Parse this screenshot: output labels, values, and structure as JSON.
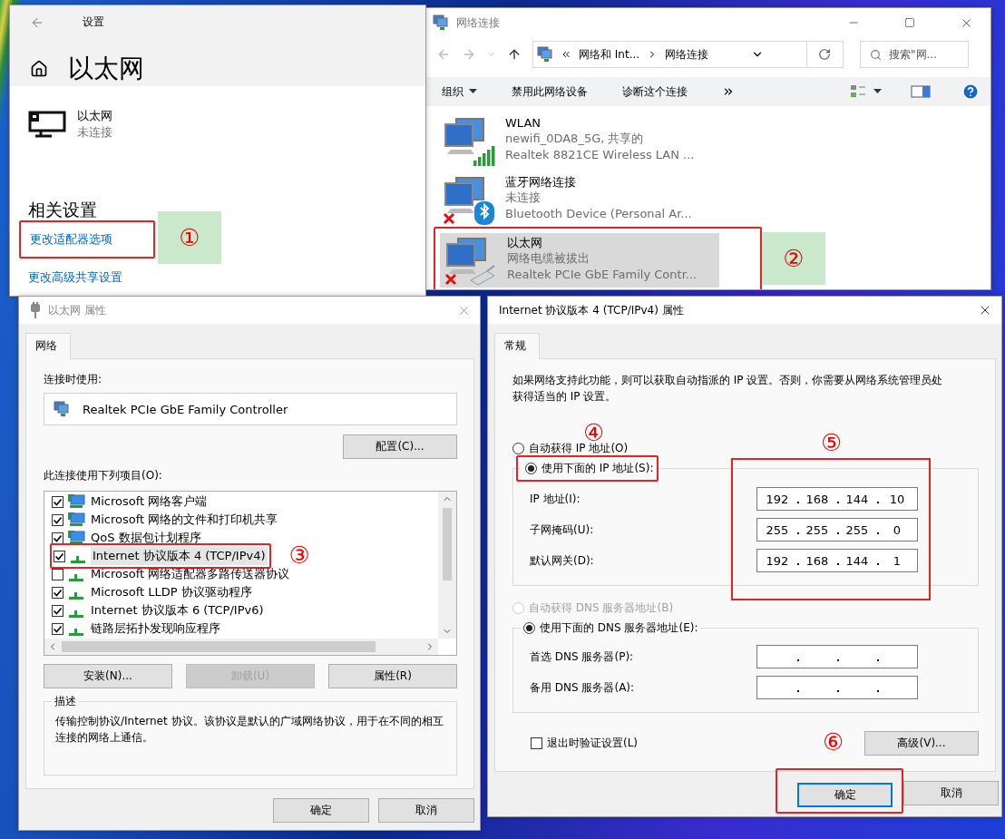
{
  "settings_window": {
    "title": "设置",
    "page_title": "以太网",
    "connection": {
      "name": "以太网",
      "status": "未连接"
    },
    "section_title": "相关设置",
    "links": [
      {
        "label": "更改适配器选项",
        "highlighted": true,
        "step": {
          "label": "①",
          "boxed": true
        }
      },
      {
        "label": "更改高级共享设置",
        "highlighted": false
      }
    ]
  },
  "network_window": {
    "title": "网络连接",
    "path": [
      "网络和 Int...",
      "网络连接"
    ],
    "search": {
      "placeholder": "搜索\"网..."
    },
    "toolbar": [
      {
        "label": "组织",
        "dropdown": true
      },
      {
        "label": "禁用此网络设备",
        "dropdown": false
      },
      {
        "label": "诊断这个连接",
        "dropdown": false
      }
    ],
    "connections": [
      {
        "name": "WLAN",
        "detail": "newifi_0DA8_5G, 共享的",
        "adapter": "Realtek 8821CE Wireless LAN ...",
        "kind": "wifi",
        "disconnected": false,
        "selected": false,
        "highlighted": false
      },
      {
        "name": "蓝牙网络连接",
        "detail": "未连接",
        "adapter": "Bluetooth Device (Personal Ar...",
        "kind": "bluetooth",
        "disconnected": true,
        "selected": false,
        "highlighted": false
      },
      {
        "name": "以太网",
        "detail": "网络电缆被拔出",
        "adapter": "Realtek PCIe GbE Family Contr...",
        "kind": "ethernet",
        "disconnected": true,
        "selected": true,
        "highlighted": true,
        "step": {
          "label": "②",
          "boxed": true
        }
      }
    ]
  },
  "ethernet_properties": {
    "title": "以太网 属性",
    "tabs": [
      {
        "label": "网络",
        "selected": true
      }
    ],
    "connect_using_label": "连接时使用:",
    "adapter": "Realtek PCIe GbE Family Controller",
    "configure_button": "配置(C)...",
    "items_label": "此连接使用下列项目(O):",
    "items": [
      {
        "label": "Microsoft 网络客户端",
        "kind": "client",
        "checked": true,
        "selected": false,
        "highlighted": false
      },
      {
        "label": "Microsoft 网络的文件和打印机共享",
        "kind": "client",
        "checked": true,
        "selected": false,
        "highlighted": false
      },
      {
        "label": "QoS 数据包计划程序",
        "kind": "client",
        "checked": true,
        "selected": false,
        "highlighted": false
      },
      {
        "label": "Internet 协议版本 4 (TCP/IPv4)",
        "kind": "protocol",
        "checked": true,
        "selected": true,
        "highlighted": true,
        "step": {
          "label": "③",
          "boxed": false
        }
      },
      {
        "label": "Microsoft 网络适配器多路传送器协议",
        "kind": "protocol",
        "checked": false,
        "selected": false,
        "highlighted": false
      },
      {
        "label": "Microsoft LLDP 协议驱动程序",
        "kind": "protocol",
        "checked": true,
        "selected": false,
        "highlighted": false
      },
      {
        "label": "Internet 协议版本 6 (TCP/IPv6)",
        "kind": "protocol",
        "checked": true,
        "selected": false,
        "highlighted": false
      },
      {
        "label": "链路层拓扑发现响应程序",
        "kind": "protocol",
        "checked": true,
        "selected": false,
        "highlighted": false
      }
    ],
    "buttons": [
      {
        "label": "安装(N)...",
        "disabled": false
      },
      {
        "label": "卸载(U)",
        "disabled": true
      },
      {
        "label": "属性(R)",
        "disabled": false
      }
    ],
    "description_label": "描述",
    "description": "传输控制协议/Internet 协议。该协议是默认的广域网络协议，用于在不同的相互连接的网络上通信。",
    "footer_buttons": [
      "确定",
      "取消"
    ]
  },
  "ipv4_properties": {
    "title": "Internet 协议版本 4 (TCP/IPv4) 属性",
    "tabs": [
      {
        "label": "常规",
        "selected": true
      }
    ],
    "intro": "如果网络支持此功能，则可以获取自动指派的 IP 设置。否则，你需要从网络系统管理员处获得适当的 IP 设置。",
    "ip_options": [
      {
        "label": "自动获得 IP 地址(O)",
        "selected": false,
        "disabled": false,
        "highlighted": false
      },
      {
        "label": "使用下面的 IP 地址(S):",
        "selected": true,
        "disabled": false,
        "highlighted": true,
        "step": {
          "label": "④",
          "boxed": false
        }
      }
    ],
    "ip_fields": [
      {
        "label": "IP 地址(I):",
        "octets": [
          "192",
          "168",
          "144",
          "10"
        ]
      },
      {
        "label": "子网掩码(U):",
        "octets": [
          "255",
          "255",
          "255",
          "0"
        ]
      },
      {
        "label": "默认网关(D):",
        "octets": [
          "192",
          "168",
          "144",
          "1"
        ]
      }
    ],
    "ip_fields_frame": {
      "highlighted": true,
      "step": {
        "label": "⑤",
        "boxed": false
      }
    },
    "dns_options": [
      {
        "label": "自动获得 DNS 服务器地址(B)",
        "selected": false,
        "disabled": true
      },
      {
        "label": "使用下面的 DNS 服务器地址(E):",
        "selected": true,
        "disabled": false
      }
    ],
    "dns_fields": [
      {
        "label": "首选 DNS 服务器(P):"
      },
      {
        "label": "备用 DNS 服务器(A):"
      }
    ],
    "validate": {
      "label": "退出时验证设置(L)",
      "checked": false
    },
    "advanced_button": "高级(V)...",
    "footer_buttons": [
      {
        "label": "确定",
        "default": true,
        "highlighted": true,
        "step": {
          "label": "⑥",
          "boxed": false
        }
      },
      {
        "label": "取消",
        "default": false,
        "highlighted": false
      }
    ]
  }
}
